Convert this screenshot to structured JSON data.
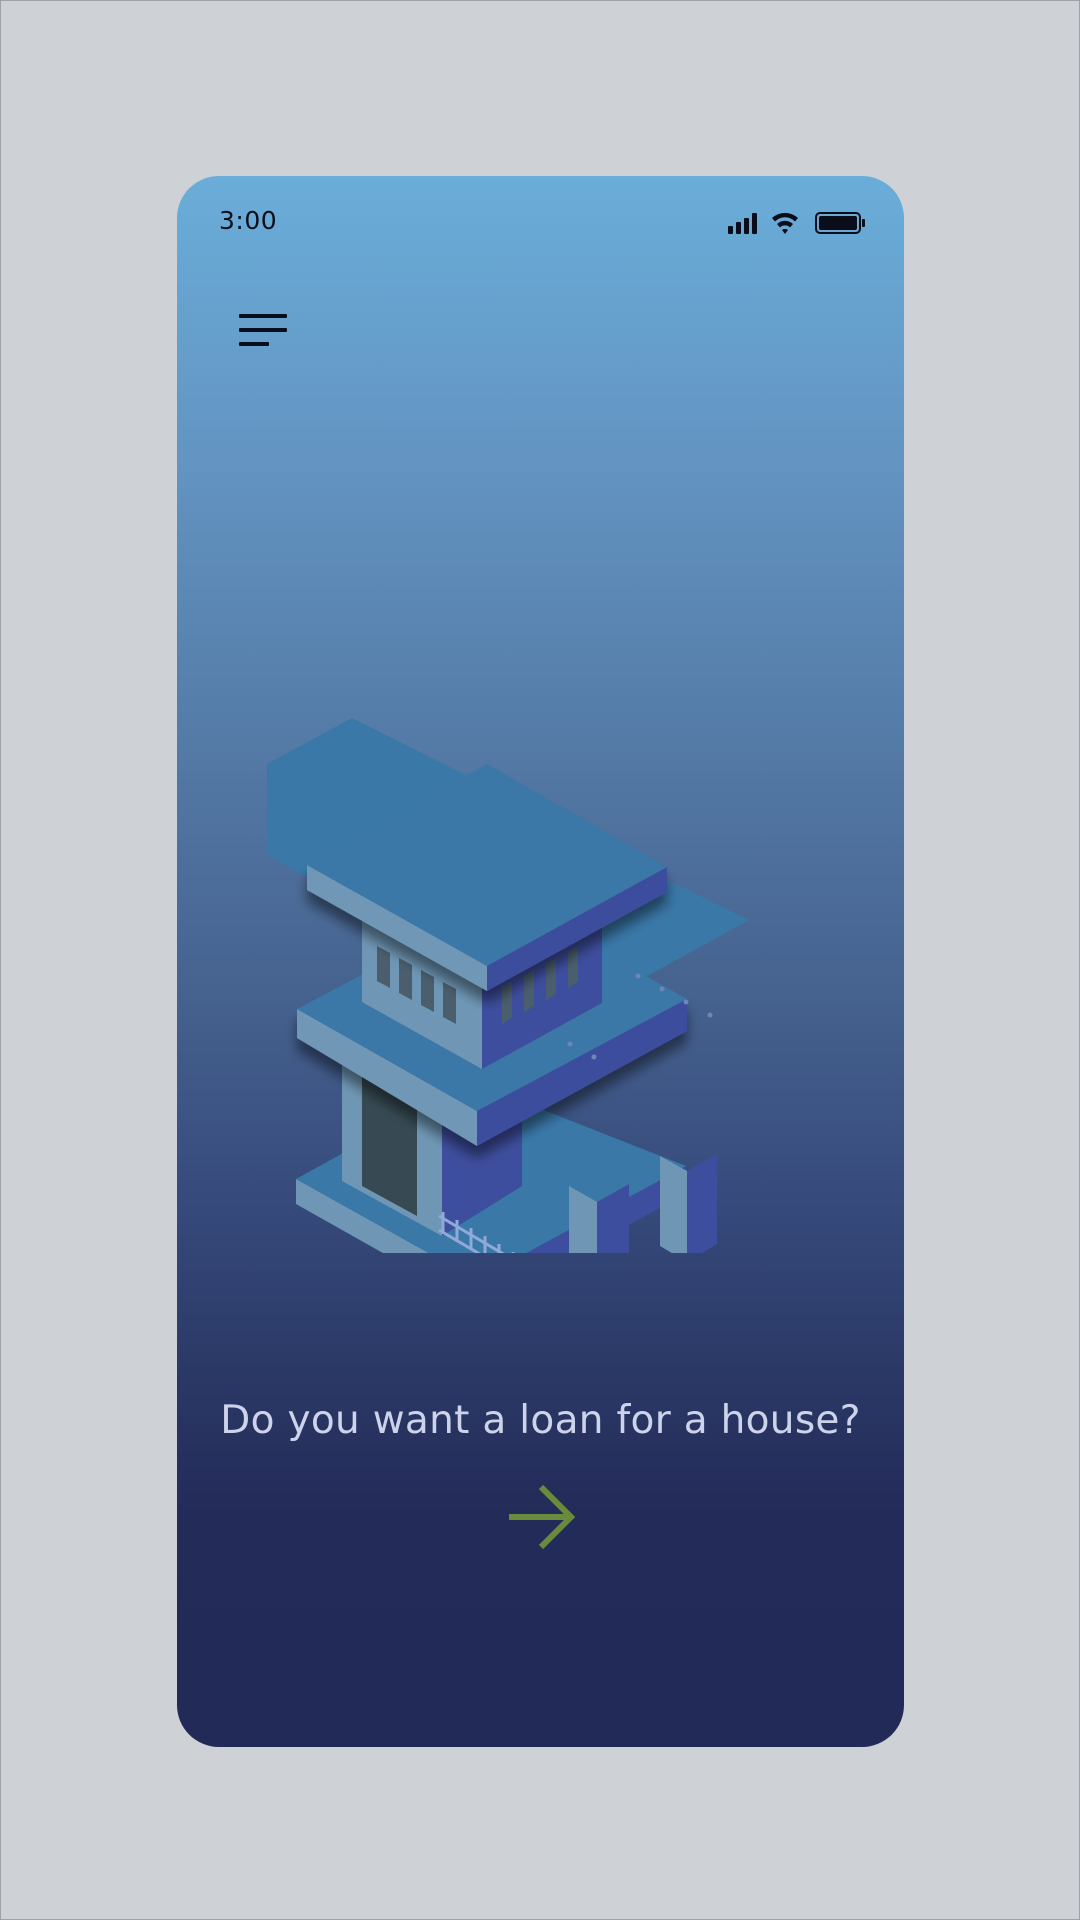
{
  "status_bar": {
    "time": "3:00",
    "icons": [
      "signal-icon",
      "wifi-icon",
      "battery-icon"
    ]
  },
  "header": {
    "menu_icon": "hamburger-menu-icon"
  },
  "illustration": {
    "name": "isometric-house-illustration"
  },
  "main": {
    "headline": "Do you want a loan for a house?",
    "next_icon": "arrow-right-icon"
  },
  "colors": {
    "page_background": "#ced1d5",
    "gradient_top": "#6aadd9",
    "gradient_bottom": "#222b58",
    "headline_text": "#cdd3ea",
    "accent_arrow": "#6a8a3c",
    "house_top": "#3a78a8",
    "house_left": "#6f97b5",
    "house_right": "#3e4e9e"
  }
}
